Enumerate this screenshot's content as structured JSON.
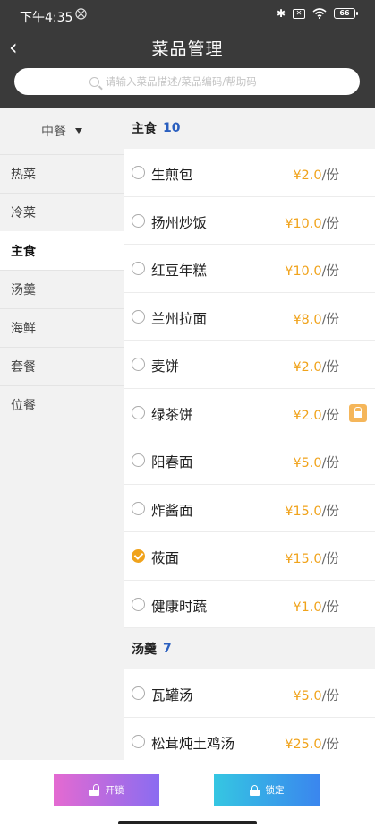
{
  "status_bar": {
    "time": "下午4:35",
    "mute_icon": "⨂",
    "bluetooth": "✱",
    "battery": "66"
  },
  "header": {
    "title": "菜品管理",
    "back_icon": "‹"
  },
  "search": {
    "placeholder": "请输入菜品描述/菜品编码/帮助码"
  },
  "sidebar": {
    "category_selector": "中餐",
    "items": [
      "热菜",
      "冷菜",
      "主食",
      "汤羹",
      "海鲜",
      "套餐",
      "位餐"
    ],
    "active": "主食"
  },
  "sections": [
    {
      "title": "主食",
      "count": "10",
      "dishes": [
        {
          "name": "生煎包",
          "price": "¥2.0",
          "unit": "/份",
          "checked": false,
          "locked": false
        },
        {
          "name": "扬州炒饭",
          "price": "¥10.0",
          "unit": "/份",
          "checked": false,
          "locked": false
        },
        {
          "name": "红豆年糕",
          "price": "¥10.0",
          "unit": "/份",
          "checked": false,
          "locked": false
        },
        {
          "name": "兰州拉面",
          "price": "¥8.0",
          "unit": "/份",
          "checked": false,
          "locked": false
        },
        {
          "name": "麦饼",
          "price": "¥2.0",
          "unit": "/份",
          "checked": false,
          "locked": false
        },
        {
          "name": "绿茶饼",
          "price": "¥2.0",
          "unit": "/份",
          "checked": false,
          "locked": true
        },
        {
          "name": "阳春面",
          "price": "¥5.0",
          "unit": "/份",
          "checked": false,
          "locked": false
        },
        {
          "name": "炸酱面",
          "price": "¥15.0",
          "unit": "/份",
          "checked": false,
          "locked": false
        },
        {
          "name": "莜面",
          "price": "¥15.0",
          "unit": "/份",
          "checked": true,
          "locked": false
        },
        {
          "name": "健康时蔬",
          "price": "¥1.0",
          "unit": "/份",
          "checked": false,
          "locked": false
        }
      ]
    },
    {
      "title": "汤羹",
      "count": "7",
      "dishes": [
        {
          "name": "瓦罐汤",
          "price": "¥5.0",
          "unit": "/份",
          "checked": false,
          "locked": false
        },
        {
          "name": "松茸炖土鸡汤",
          "price": "¥25.0",
          "unit": "/份",
          "checked": false,
          "locked": false
        }
      ]
    }
  ],
  "bottom_bar": {
    "unlock_label": "开锁",
    "lock_label": "锁定"
  },
  "colors": {
    "accent": "#f0a31c",
    "header_bg": "#3a3a3a",
    "count_blue": "#2a5fbf"
  }
}
